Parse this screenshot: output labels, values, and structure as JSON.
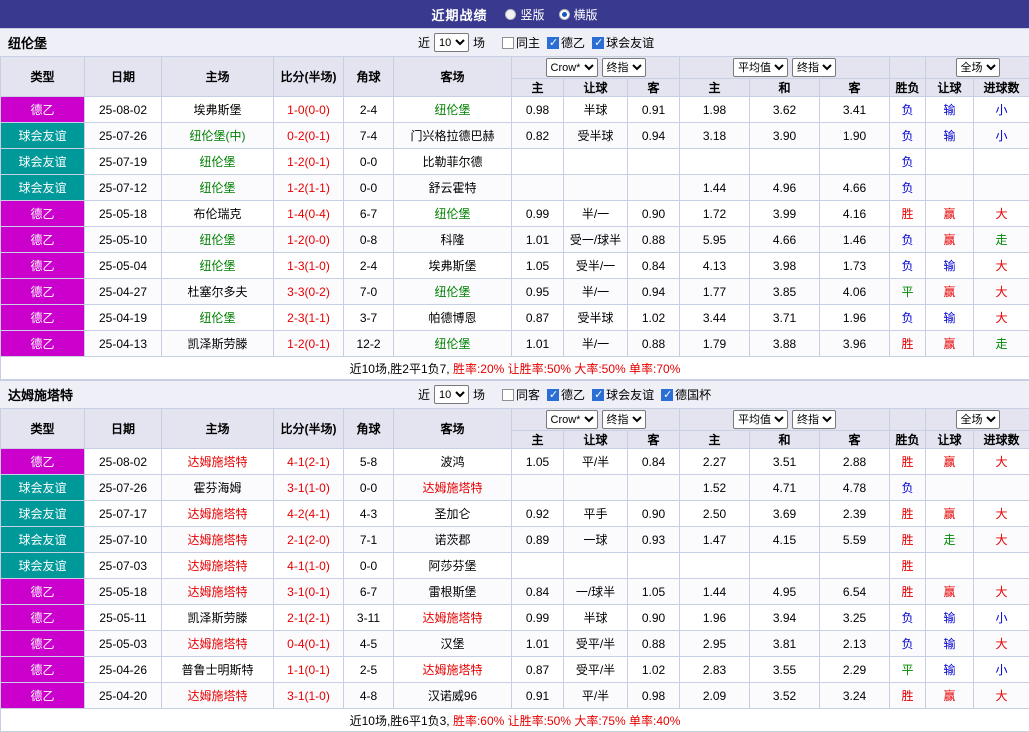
{
  "topbar": {
    "title": "近期战绩",
    "view_options": [
      {
        "label": "竖版",
        "selected": false
      },
      {
        "label": "横版",
        "selected": true
      }
    ]
  },
  "columns": [
    "类型",
    "日期",
    "主场",
    "比分(半场)",
    "角球",
    "客场",
    "主",
    "让球",
    "客",
    "主",
    "和",
    "客",
    "胜负",
    "让球",
    "进球数"
  ],
  "odds_header": {
    "asian": [
      "Crow*",
      "终指"
    ],
    "euro": [
      "平均值",
      "终指"
    ],
    "full": "全场"
  },
  "colors": {
    "topbar_bg": "#39398f",
    "header_bg": "#e4e4f1",
    "grid_line": "#c9cfe2",
    "score_text": "#e60000",
    "summary_stats": "#e60000",
    "type_colors": {
      "德乙": "#cc00cc",
      "球会友谊": "#009999",
      "德国杯": "#3366cc"
    },
    "result_colors": {
      "胜": "#e60000",
      "平": "#008800",
      "负": "#0000cc",
      "赢": "#e60000",
      "走": "#008800",
      "输": "#0000cc",
      "大": "#e60000",
      "小": "#0000cc"
    }
  },
  "sections": [
    {
      "team": "纽伦堡",
      "team_color": "#008000",
      "filter": {
        "near_label": "近",
        "count": "10",
        "games_label": "场",
        "checkboxes": [
          {
            "label": "同主",
            "checked": false
          },
          {
            "label": "德乙",
            "checked": true
          },
          {
            "label": "球会友谊",
            "checked": true
          }
        ]
      },
      "rows": [
        {
          "type": "德乙",
          "date": "25-08-02",
          "home": "埃弗斯堡",
          "highlight": "away",
          "score": "1-0(0-0)",
          "corner": "2-4",
          "away": "纽伦堡",
          "ah": [
            "0.98",
            "半球",
            "0.91"
          ],
          "eu": [
            "1.98",
            "3.62",
            "3.41"
          ],
          "res": [
            "负",
            "输",
            "小"
          ]
        },
        {
          "type": "球会友谊",
          "date": "25-07-26",
          "home": "纽伦堡(中)",
          "highlight": "home",
          "score": "0-2(0-1)",
          "corner": "7-4",
          "away": "门兴格拉德巴赫",
          "ah": [
            "0.82",
            "受半球",
            "0.94"
          ],
          "eu": [
            "3.18",
            "3.90",
            "1.90"
          ],
          "res": [
            "负",
            "输",
            "小"
          ]
        },
        {
          "type": "球会友谊",
          "date": "25-07-19",
          "home": "纽伦堡",
          "highlight": "home",
          "score": "1-2(0-1)",
          "corner": "0-0",
          "away": "比勒菲尔德",
          "ah": [
            "",
            "",
            ""
          ],
          "eu": [
            "",
            "",
            ""
          ],
          "res": [
            "负",
            "",
            ""
          ]
        },
        {
          "type": "球会友谊",
          "date": "25-07-12",
          "home": "纽伦堡",
          "highlight": "home",
          "score": "1-2(1-1)",
          "corner": "0-0",
          "away": "舒云霍特",
          "ah": [
            "",
            "",
            ""
          ],
          "eu": [
            "1.44",
            "4.96",
            "4.66"
          ],
          "res": [
            "负",
            "",
            ""
          ]
        },
        {
          "type": "德乙",
          "date": "25-05-18",
          "home": "布伦瑞克",
          "highlight": "away",
          "score": "1-4(0-4)",
          "corner": "6-7",
          "away": "纽伦堡",
          "ah": [
            "0.99",
            "半/一",
            "0.90"
          ],
          "eu": [
            "1.72",
            "3.99",
            "4.16"
          ],
          "res": [
            "胜",
            "赢",
            "大"
          ]
        },
        {
          "type": "德乙",
          "date": "25-05-10",
          "home": "纽伦堡",
          "highlight": "home",
          "score": "1-2(0-0)",
          "corner": "0-8",
          "away": "科隆",
          "ah": [
            "1.01",
            "受一/球半",
            "0.88"
          ],
          "eu": [
            "5.95",
            "4.66",
            "1.46"
          ],
          "res": [
            "负",
            "赢",
            "走"
          ]
        },
        {
          "type": "德乙",
          "date": "25-05-04",
          "home": "纽伦堡",
          "highlight": "home",
          "score": "1-3(1-0)",
          "corner": "2-4",
          "away": "埃弗斯堡",
          "ah": [
            "1.05",
            "受半/一",
            "0.84"
          ],
          "eu": [
            "4.13",
            "3.98",
            "1.73"
          ],
          "res": [
            "负",
            "输",
            "大"
          ]
        },
        {
          "type": "德乙",
          "date": "25-04-27",
          "home": "杜塞尔多夫",
          "highlight": "away",
          "score": "3-3(0-2)",
          "corner": "7-0",
          "away": "纽伦堡",
          "ah": [
            "0.95",
            "半/一",
            "0.94"
          ],
          "eu": [
            "1.77",
            "3.85",
            "4.06"
          ],
          "res": [
            "平",
            "赢",
            "大"
          ]
        },
        {
          "type": "德乙",
          "date": "25-04-19",
          "home": "纽伦堡",
          "highlight": "home",
          "score": "2-3(1-1)",
          "corner": "3-7",
          "away": "帕德博恩",
          "ah": [
            "0.87",
            "受半球",
            "1.02"
          ],
          "eu": [
            "3.44",
            "3.71",
            "1.96"
          ],
          "res": [
            "负",
            "输",
            "大"
          ]
        },
        {
          "type": "德乙",
          "date": "25-04-13",
          "home": "凯泽斯劳滕",
          "highlight": "away",
          "score": "1-2(0-1)",
          "corner": "12-2",
          "away": "纽伦堡",
          "ah": [
            "1.01",
            "半/一",
            "0.88"
          ],
          "eu": [
            "1.79",
            "3.88",
            "3.96"
          ],
          "res": [
            "胜",
            "赢",
            "走"
          ]
        }
      ],
      "summary": {
        "prefix": "近10场,胜2平1负7,",
        "stats": [
          "胜率:20%",
          "让胜率:50%",
          "大率:50%",
          "单率:70%"
        ]
      }
    },
    {
      "team": "达姆施塔特",
      "team_color": "#e60000",
      "filter": {
        "near_label": "近",
        "count": "10",
        "games_label": "场",
        "checkboxes": [
          {
            "label": "同客",
            "checked": false
          },
          {
            "label": "德乙",
            "checked": true
          },
          {
            "label": "球会友谊",
            "checked": true
          },
          {
            "label": "德国杯",
            "checked": true
          }
        ]
      },
      "rows": [
        {
          "type": "德乙",
          "date": "25-08-02",
          "home": "达姆施塔特",
          "highlight": "home",
          "score": "4-1(2-1)",
          "corner": "5-8",
          "away": "波鸿",
          "ah": [
            "1.05",
            "平/半",
            "0.84"
          ],
          "eu": [
            "2.27",
            "3.51",
            "2.88"
          ],
          "res": [
            "胜",
            "赢",
            "大"
          ]
        },
        {
          "type": "球会友谊",
          "date": "25-07-26",
          "home": "霍芬海姆",
          "highlight": "away",
          "score": "3-1(1-0)",
          "corner": "0-0",
          "away": "达姆施塔特",
          "ah": [
            "",
            "",
            ""
          ],
          "eu": [
            "1.52",
            "4.71",
            "4.78"
          ],
          "res": [
            "负",
            "",
            ""
          ]
        },
        {
          "type": "球会友谊",
          "date": "25-07-17",
          "home": "达姆施塔特",
          "highlight": "home",
          "score": "4-2(4-1)",
          "corner": "4-3",
          "away": "圣加仑",
          "ah": [
            "0.92",
            "平手",
            "0.90"
          ],
          "eu": [
            "2.50",
            "3.69",
            "2.39"
          ],
          "res": [
            "胜",
            "赢",
            "大"
          ]
        },
        {
          "type": "球会友谊",
          "date": "25-07-10",
          "home": "达姆施塔特",
          "highlight": "home",
          "score": "2-1(2-0)",
          "corner": "7-1",
          "away": "诺茨郡",
          "ah": [
            "0.89",
            "一球",
            "0.93"
          ],
          "eu": [
            "1.47",
            "4.15",
            "5.59"
          ],
          "res": [
            "胜",
            "走",
            "大"
          ]
        },
        {
          "type": "球会友谊",
          "date": "25-07-03",
          "home": "达姆施塔特",
          "highlight": "home",
          "score": "4-1(1-0)",
          "corner": "0-0",
          "away": "阿莎芬堡",
          "ah": [
            "",
            "",
            ""
          ],
          "eu": [
            "",
            "",
            ""
          ],
          "res": [
            "胜",
            "",
            ""
          ]
        },
        {
          "type": "德乙",
          "date": "25-05-18",
          "home": "达姆施塔特",
          "highlight": "home",
          "score": "3-1(0-1)",
          "corner": "6-7",
          "away": "雷根斯堡",
          "ah": [
            "0.84",
            "一/球半",
            "1.05"
          ],
          "eu": [
            "1.44",
            "4.95",
            "6.54"
          ],
          "res": [
            "胜",
            "赢",
            "大"
          ]
        },
        {
          "type": "德乙",
          "date": "25-05-11",
          "home": "凯泽斯劳滕",
          "highlight": "away",
          "score": "2-1(2-1)",
          "corner": "3-11",
          "away": "达姆施塔特",
          "ah": [
            "0.99",
            "半球",
            "0.90"
          ],
          "eu": [
            "1.96",
            "3.94",
            "3.25"
          ],
          "res": [
            "负",
            "输",
            "小"
          ]
        },
        {
          "type": "德乙",
          "date": "25-05-03",
          "home": "达姆施塔特",
          "highlight": "home",
          "score": "0-4(0-1)",
          "corner": "4-5",
          "away": "汉堡",
          "ah": [
            "1.01",
            "受平/半",
            "0.88"
          ],
          "eu": [
            "2.95",
            "3.81",
            "2.13"
          ],
          "res": [
            "负",
            "输",
            "大"
          ]
        },
        {
          "type": "德乙",
          "date": "25-04-26",
          "home": "普鲁士明斯特",
          "highlight": "away",
          "score": "1-1(0-1)",
          "corner": "2-5",
          "away": "达姆施塔特",
          "ah": [
            "0.87",
            "受平/半",
            "1.02"
          ],
          "eu": [
            "2.83",
            "3.55",
            "2.29"
          ],
          "res": [
            "平",
            "输",
            "小"
          ]
        },
        {
          "type": "德乙",
          "date": "25-04-20",
          "home": "达姆施塔特",
          "highlight": "home",
          "score": "3-1(1-0)",
          "corner": "4-8",
          "away": "汉诺威96",
          "ah": [
            "0.91",
            "平/半",
            "0.98"
          ],
          "eu": [
            "2.09",
            "3.52",
            "3.24"
          ],
          "res": [
            "胜",
            "赢",
            "大"
          ]
        }
      ],
      "summary": {
        "prefix": "近10场,胜6平1负3,",
        "stats": [
          "胜率:60%",
          "让胜率:50%",
          "大率:75%",
          "单率:40%"
        ]
      }
    }
  ]
}
